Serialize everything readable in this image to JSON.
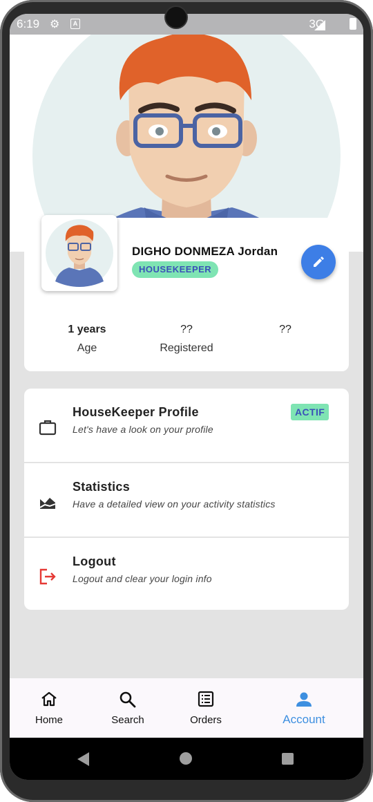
{
  "status_bar": {
    "time": "6:19",
    "a_label": "A",
    "network": "3G"
  },
  "profile": {
    "name": "DIGHO DONMEZA Jordan",
    "role": "HOUSEKEEPER",
    "stats": [
      {
        "value": "1 years",
        "label": "Age"
      },
      {
        "value": "??",
        "label": "Registered"
      },
      {
        "value": "??",
        "label": ""
      }
    ]
  },
  "menu": [
    {
      "title": "HouseKeeper Profile",
      "subtitle": "Let's have a look on your profile",
      "badge": "ACTIF",
      "icon": "briefcase-icon"
    },
    {
      "title": "Statistics",
      "subtitle": "Have a detailed view on your activity statistics",
      "icon": "chart-area-icon"
    },
    {
      "title": "Logout",
      "subtitle": "Logout and clear your login info",
      "icon": "logout-icon"
    }
  ],
  "bottom_nav": [
    {
      "label": "Home",
      "icon": "home-icon"
    },
    {
      "label": "Search",
      "icon": "search-icon"
    },
    {
      "label": "Orders",
      "icon": "orders-icon"
    },
    {
      "label": "Account",
      "icon": "account-icon",
      "active": true
    }
  ],
  "colors": {
    "accent": "#3d7ee6",
    "badge_bg": "#7fe4b3",
    "badge_text": "#3a50b8",
    "active_nav": "#3d8fe0",
    "logout_red": "#e53935"
  }
}
